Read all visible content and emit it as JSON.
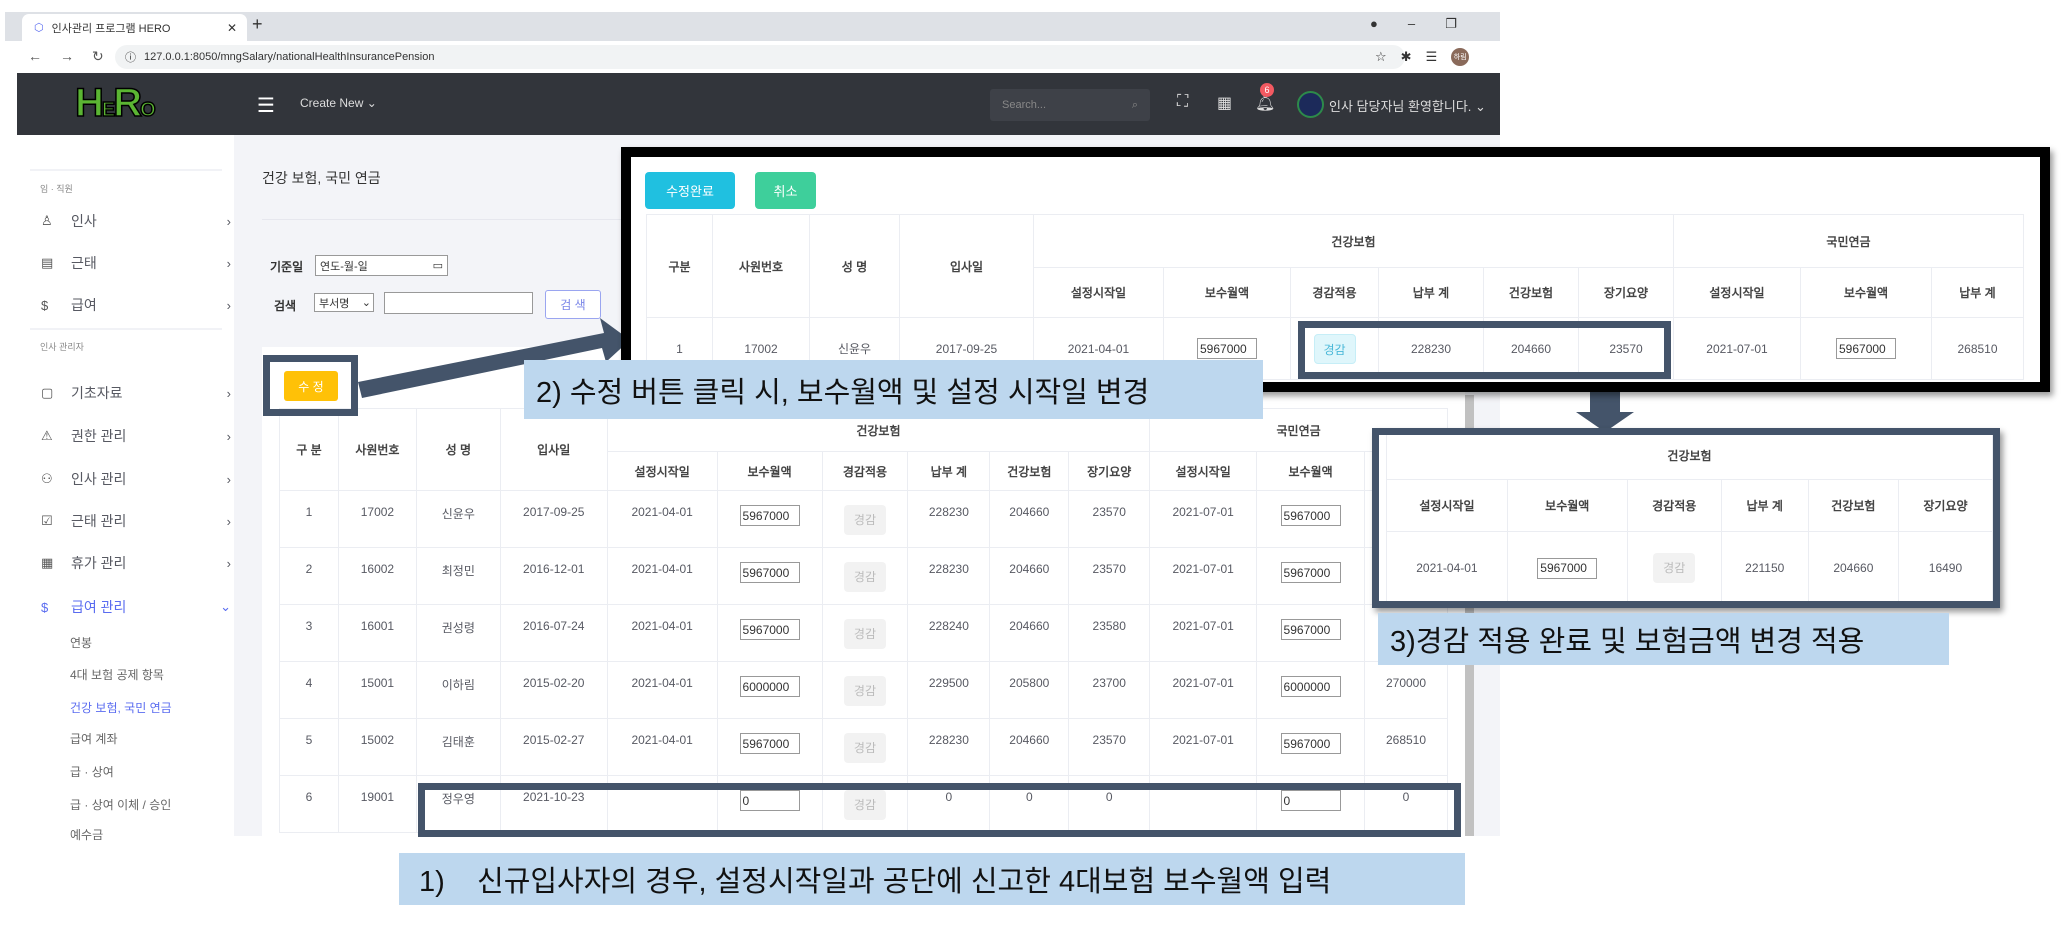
{
  "browser": {
    "tab_title": "인사관리 프로그램 HERO",
    "url": "127.0.0.1:8050/mngSalary/nationalHealthInsurancePension",
    "profile": "하림"
  },
  "header": {
    "logo": "HERO",
    "create_new": "Create New",
    "search_placeholder": "Search...",
    "notification_count": "6",
    "welcome": "인사 담당자님 환영합니다."
  },
  "sidebar": {
    "section1": "임 · 직원",
    "items1": [
      {
        "label": "인사",
        "icon": "user-icon"
      },
      {
        "label": "근태",
        "icon": "briefcase-icon"
      },
      {
        "label": "급여",
        "icon": "dollar-icon"
      }
    ],
    "section2": "인사 관리자",
    "items2": [
      {
        "label": "기초자료",
        "icon": "clipboard-icon"
      },
      {
        "label": "권한 관리",
        "icon": "warning-icon"
      },
      {
        "label": "인사 관리",
        "icon": "users-icon"
      },
      {
        "label": "근태 관리",
        "icon": "checkbox-icon"
      },
      {
        "label": "휴가 관리",
        "icon": "calendar-icon"
      },
      {
        "label": "급여 관리",
        "icon": "dollar-icon"
      }
    ],
    "submenu": [
      "연봉",
      "4대 보험 공제 항목",
      "건강 보험, 국민 연금",
      "급여 계좌",
      "급 · 상여",
      "급 · 상여 이체 / 승인",
      "예수금"
    ]
  },
  "page": {
    "title": "건강 보험, 국민 연금",
    "date_label": "기준일",
    "date_placeholder": "연도-월-일",
    "search_label": "검색",
    "search_select": "부서명",
    "search_value": "",
    "search_button": "검 색",
    "edit_button": "수 정"
  },
  "headers": {
    "no": "구 분",
    "emp_no": "사원번호",
    "name": "성 명",
    "hire_date": "입사일",
    "health": "건강보험",
    "pension": "국민연금",
    "sub": [
      "설정시작일",
      "보수월액",
      "경감적용",
      "납부 계",
      "건강보험",
      "장기요양",
      "설정시작일",
      "보수월액",
      "납부 계"
    ]
  },
  "reduction_label": "경감",
  "main_table": {
    "rows": [
      {
        "no": "1",
        "emp_no": "17002",
        "name": "신윤우",
        "hire_date": "2017-09-25",
        "hi_start": "2021-04-01",
        "hi_salary": "5967000",
        "hi_total": "228230",
        "hi_health": "204660",
        "hi_ltc": "23570",
        "np_start": "2021-07-01",
        "np_salary": "5967000",
        "np_total": ""
      },
      {
        "no": "2",
        "emp_no": "16002",
        "name": "최정민",
        "hire_date": "2016-12-01",
        "hi_start": "2021-04-01",
        "hi_salary": "5967000",
        "hi_total": "228230",
        "hi_health": "204660",
        "hi_ltc": "23570",
        "np_start": "2021-07-01",
        "np_salary": "5967000",
        "np_total": ""
      },
      {
        "no": "3",
        "emp_no": "16001",
        "name": "권성령",
        "hire_date": "2016-07-24",
        "hi_start": "2021-04-01",
        "hi_salary": "5967000",
        "hi_total": "228240",
        "hi_health": "204660",
        "hi_ltc": "23580",
        "np_start": "2021-07-01",
        "np_salary": "5967000",
        "np_total": ""
      },
      {
        "no": "4",
        "emp_no": "15001",
        "name": "이하림",
        "hire_date": "2015-02-20",
        "hi_start": "2021-04-01",
        "hi_salary": "6000000",
        "hi_total": "229500",
        "hi_health": "205800",
        "hi_ltc": "23700",
        "np_start": "2021-07-01",
        "np_salary": "6000000",
        "np_total": "270000"
      },
      {
        "no": "5",
        "emp_no": "15002",
        "name": "김태훈",
        "hire_date": "2015-02-27",
        "hi_start": "2021-04-01",
        "hi_salary": "5967000",
        "hi_total": "228230",
        "hi_health": "204660",
        "hi_ltc": "23570",
        "np_start": "2021-07-01",
        "np_salary": "5967000",
        "np_total": "268510"
      },
      {
        "no": "6",
        "emp_no": "19001",
        "name": "정우영",
        "hire_date": "2021-10-23",
        "hi_start": "",
        "hi_salary": "0",
        "hi_total": "0",
        "hi_health": "0",
        "hi_ltc": "0",
        "np_start": "",
        "np_salary": "0",
        "np_total": "0"
      }
    ]
  },
  "edit_overlay": {
    "save_button": "수정완료",
    "cancel_button": "취소",
    "headers": {
      "no": "구분"
    },
    "rows": [
      {
        "no": "1",
        "emp_no": "17002",
        "name": "신윤우",
        "hire_date": "2017-09-25",
        "hi_start": "2021-04-01",
        "hi_salary": "5967000",
        "hi_total": "228230",
        "hi_health": "204660",
        "hi_ltc": "23570",
        "np_start": "2021-07-01",
        "np_salary": "5967000",
        "np_total": "268510"
      }
    ]
  },
  "result_overlay": {
    "rows": [
      {
        "hi_start": "2021-04-01",
        "hi_salary": "5967000",
        "hi_total": "221150",
        "hi_health": "204660",
        "hi_ltc": "16490"
      }
    ]
  },
  "callouts": {
    "step1": "1)    신규입사자의 경우, 설정시작일과 공단에 신고한 4대보험 보수월액 입력",
    "step2": "2) 수정 버튼 클릭 시, 보수월액 및 설정 시작일 변경",
    "step3": "3)경감 적용 완료 및 보험금액 변경 적용"
  },
  "colors": {
    "header_bg": "#32353b",
    "accent": "#5a6cf0",
    "edit_yellow": "#ffc107",
    "save_cyan": "#20c0e0",
    "cancel_green": "#3ecf9b",
    "callout_bg": "#bdd7ee",
    "highlight_border": "#44546a"
  }
}
